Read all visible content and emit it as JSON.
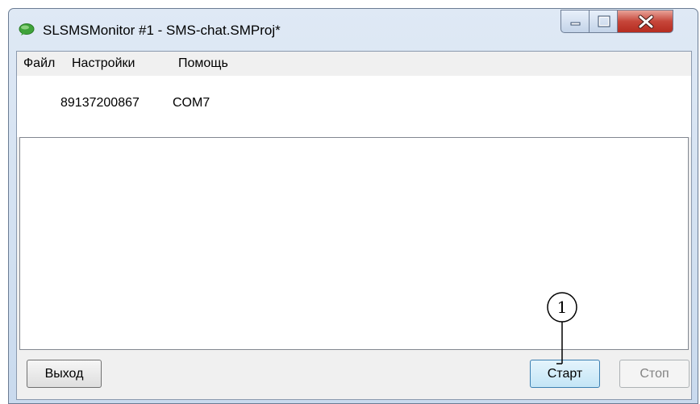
{
  "window": {
    "title": "SLSMSMonitor #1 - SMS-chat.SMProj*",
    "icons": {
      "app": "speech-bubble-icon",
      "minimize": "minimize-icon",
      "maximize": "maximize-icon",
      "close": "close-icon"
    }
  },
  "menu": {
    "file": "Файл",
    "settings": "Настройки",
    "help": "Помощь"
  },
  "info": {
    "phone": "89137200867",
    "port": "COM7"
  },
  "buttons": {
    "exit": "Выход",
    "start": "Старт",
    "stop": "Стоп"
  },
  "callout": {
    "number": "1"
  },
  "colors": {
    "accent_button_border": "#3c7fb1",
    "close_button": "#c6463a",
    "app_icon": "#3fa33a"
  }
}
